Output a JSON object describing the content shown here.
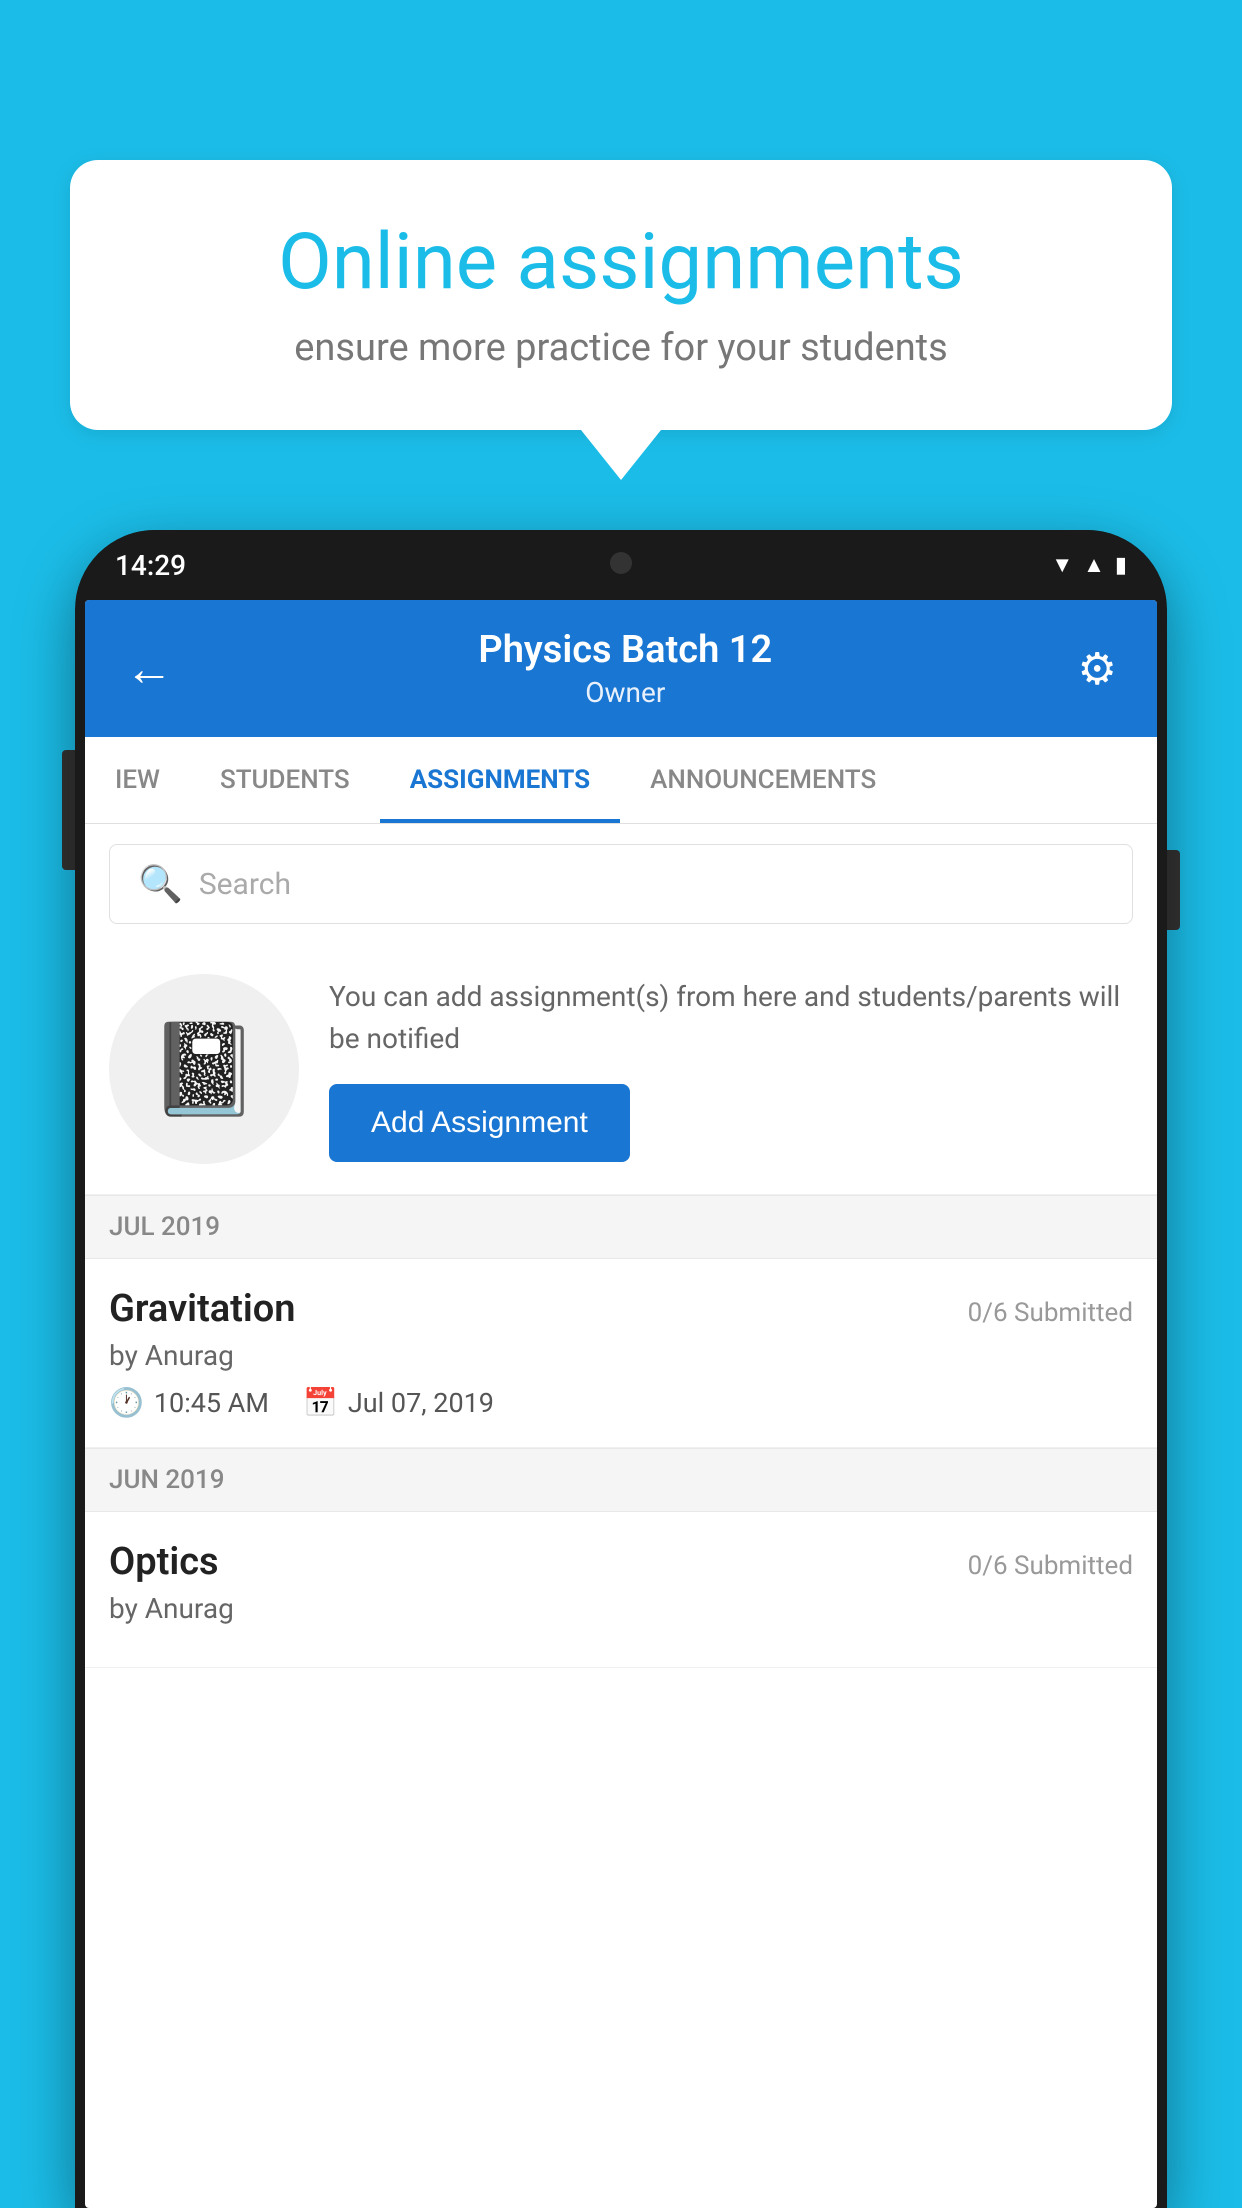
{
  "background_color": "#1BBDE8",
  "bubble": {
    "title": "Online assignments",
    "subtitle": "ensure more practice for your students"
  },
  "status_bar": {
    "time": "14:29",
    "icons": [
      "wifi",
      "signal",
      "battery"
    ]
  },
  "header": {
    "title": "Physics Batch 12",
    "subtitle": "Owner",
    "back_label": "←",
    "gear_label": "⚙"
  },
  "tabs": [
    {
      "label": "IEW",
      "active": false
    },
    {
      "label": "STUDENTS",
      "active": false
    },
    {
      "label": "ASSIGNMENTS",
      "active": true
    },
    {
      "label": "ANNOUNCEMENTS",
      "active": false
    }
  ],
  "search": {
    "placeholder": "Search"
  },
  "promo": {
    "description": "You can add assignment(s) from here and students/parents will be notified",
    "button_label": "Add Assignment"
  },
  "sections": [
    {
      "month": "JUL 2019",
      "assignments": [
        {
          "name": "Gravitation",
          "submitted": "0/6 Submitted",
          "by": "by Anurag",
          "time": "10:45 AM",
          "date": "Jul 07, 2019"
        }
      ]
    },
    {
      "month": "JUN 2019",
      "assignments": [
        {
          "name": "Optics",
          "submitted": "0/6 Submitted",
          "by": "by Anurag",
          "time": "",
          "date": ""
        }
      ]
    }
  ]
}
